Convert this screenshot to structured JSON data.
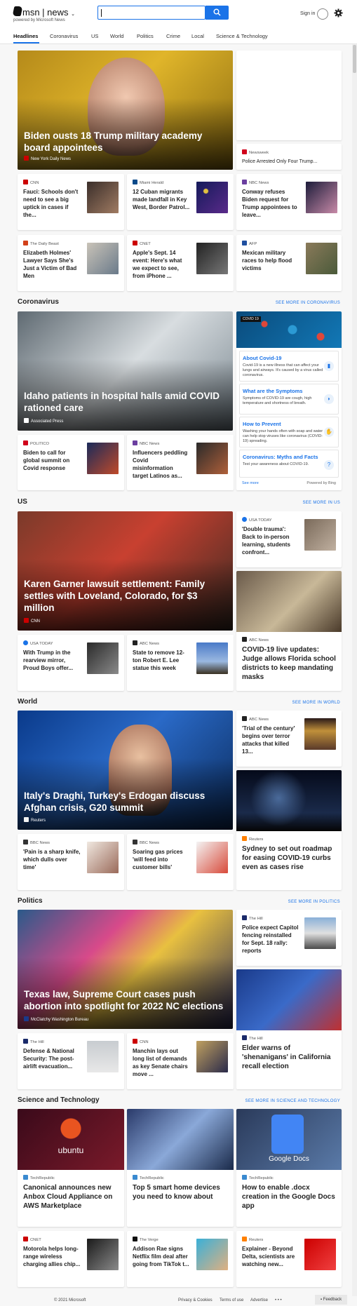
{
  "header": {
    "logo": "msn",
    "product": "news",
    "tagline": "powered by Microsoft News",
    "search_value": "",
    "signin": "Sign in"
  },
  "nav": [
    "Headlines",
    "Coronavirus",
    "US",
    "World",
    "Politics",
    "Crime",
    "Local",
    "Science & Technology"
  ],
  "headlines": {
    "hero": {
      "title": "Biden ousts 18 Trump military academy board appointees",
      "source": "New York Daily News"
    },
    "side_top": {
      "source": "Newsweek",
      "title": "Police Arrested Only Four Trump..."
    },
    "cards": [
      {
        "source": "CNN",
        "title": "Fauci: Schools don't need to see a big uptick in cases if the..."
      },
      {
        "source": "Miami Herald",
        "title": "12 Cuban migrants made landfall in Key West, Border Patrol..."
      },
      {
        "source": "NBC News",
        "title": "Conway refuses Biden request for Trump appointees to leave..."
      },
      {
        "source": "The Daily Beast",
        "title": "Elizabeth Holmes' Lawyer Says She's Just a Victim of Bad Men"
      },
      {
        "source": "CNET",
        "title": "Apple's Sept. 14 event: Here's what we expect to see, from iPhone ..."
      },
      {
        "source": "AFP",
        "title": "Mexican military races to help flood victims"
      }
    ]
  },
  "coronavirus": {
    "title": "Coronavirus",
    "see_more": "SEE MORE IN CORONAVIRUS",
    "hero": {
      "title": "Idaho patients in hospital halls amid COVID rationed care",
      "source": "Associated Press"
    },
    "cards": [
      {
        "source": "POLITICO",
        "title": "Biden to call for global summit on Covid response"
      },
      {
        "source": "NBC News",
        "title": "Influencers peddling Covid misinformation target Latinos as..."
      }
    ],
    "panel": {
      "tag": "COVID 19",
      "items": [
        {
          "title": "About Covid-19",
          "body": "Covid-19 is a new illness that can affect your lungs and airways. It's caused by a virus called coronavirus."
        },
        {
          "title": "What are the Symptoms",
          "body": "Symptoms of COVID-19 are cough, high temperature and shortness of breath."
        },
        {
          "title": "How to Prevent",
          "body": "Washing your hands often with soap and water can help stop viruses like coronavirus (COVID-19) spreading."
        },
        {
          "title": "Coronavirus: Myths and Facts",
          "body": "Test your awareness about COVID-19."
        }
      ],
      "see_more": "See more",
      "powered": "Powered by Bing"
    }
  },
  "us": {
    "title": "US",
    "see_more": "SEE MORE IN US",
    "hero": {
      "title": "Karen Garner lawsuit settlement: Family settles with Loveland, Colorado, for $3 million",
      "source": "CNN"
    },
    "side_top": {
      "source": "USA TODAY",
      "title": "'Double trauma': Back to in-person learning, students confront..."
    },
    "side_big": {
      "source": "ABC News",
      "title": "COVID-19 live updates: Judge allows Florida school districts to keep mandating masks"
    },
    "cards": [
      {
        "source": "USA TODAY",
        "title": "With Trump in the rearview mirror, Proud Boys offer..."
      },
      {
        "source": "ABC News",
        "title": "State to remove 12-ton Robert E. Lee statue this week"
      }
    ]
  },
  "world": {
    "title": "World",
    "see_more": "SEE MORE IN WORLD",
    "hero": {
      "title": "Italy's Draghi, Turkey's Erdogan discuss Afghan crisis, G20 summit",
      "source": "Reuters"
    },
    "side_top": {
      "source": "ABC News",
      "title": "'Trial of the century' begins over terror attacks that killed 13..."
    },
    "side_big": {
      "source": "Reuters",
      "title": "Sydney to set out roadmap for easing COVID-19 curbs even as cases rise"
    },
    "cards": [
      {
        "source": "BBC News",
        "title": "'Pain is a sharp knife, which dulls over time'"
      },
      {
        "source": "BBC News",
        "title": "Soaring gas prices 'will feed into customer bills'"
      }
    ]
  },
  "politics": {
    "title": "Politics",
    "see_more": "SEE MORE IN POLITICS",
    "hero": {
      "title": "Texas law, Supreme Court cases push abortion into spotlight for 2022 NC elections",
      "source": "McClatchy Washington Bureau"
    },
    "side_top": {
      "source": "The Hill",
      "title": "Police expect Capitol fencing reinstalled for Sept. 18 rally: reports"
    },
    "side_big": {
      "source": "The Hill",
      "title": "Elder warns of 'shenanigans' in California recall election"
    },
    "cards": [
      {
        "source": "The Hill",
        "title": "Defense & National Security: The post-airlift evacuation..."
      },
      {
        "source": "CNN",
        "title": "Manchin lays out long list of demands as key Senate chairs move ..."
      }
    ]
  },
  "scitech": {
    "title": "Science and Technology",
    "see_more": "SEE MORE IN SCIENCE AND TECHNOLOGY",
    "big": [
      {
        "source": "TechRepublic",
        "title": "Canonical announces new Anbox Cloud Appliance on AWS Marketplace",
        "img_text": "ubuntu"
      },
      {
        "source": "TechRepublic",
        "title": "Top 5 smart home devices you need to know about"
      },
      {
        "source": "TechRepublic",
        "title": "How to enable .docx creation in the Google Docs app",
        "img_text": "Google Docs"
      }
    ],
    "cards": [
      {
        "source": "CNET",
        "title": "Motorola helps long-range wireless charging allies chip..."
      },
      {
        "source": "The Verge",
        "title": "Addison Rae signs Netflix film deal after going from TikTok t..."
      },
      {
        "source": "Reuters",
        "title": "Explainer - Beyond Delta, scientists are watching new..."
      }
    ]
  },
  "footer": {
    "copyright": "© 2021 Microsoft",
    "links": [
      "Privacy & Cookies",
      "Terms of use",
      "Advertise",
      "• • •"
    ],
    "feedback": "Feedback"
  }
}
